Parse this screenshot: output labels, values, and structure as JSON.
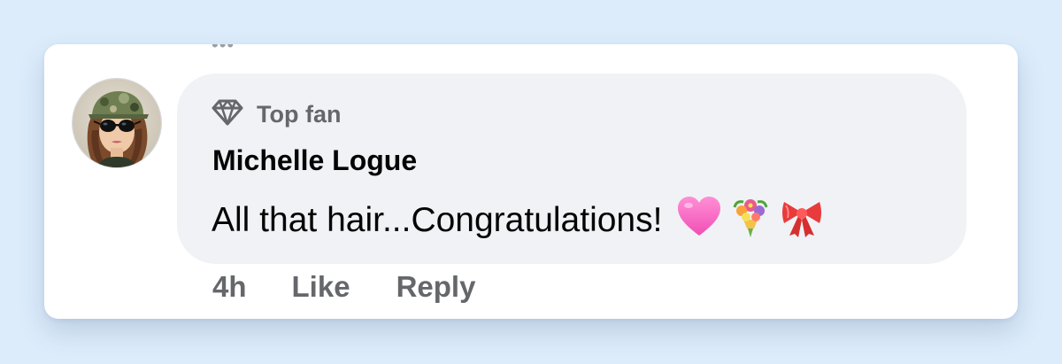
{
  "comment": {
    "badge_icon": "diamond-icon",
    "badge_label": "Top fan",
    "author": "Michelle Logue",
    "text": "All that hair...Congratulations!",
    "emojis": [
      "pink-heart-icon",
      "bouquet-icon",
      "ribbon-icon"
    ]
  },
  "actions": {
    "time": "4h",
    "like_label": "Like",
    "reply_label": "Reply"
  },
  "colors": {
    "page_background": "#dcecfb",
    "bubble_background": "#f0f2f5",
    "secondary_text": "#65676b",
    "primary_text": "#050505"
  }
}
